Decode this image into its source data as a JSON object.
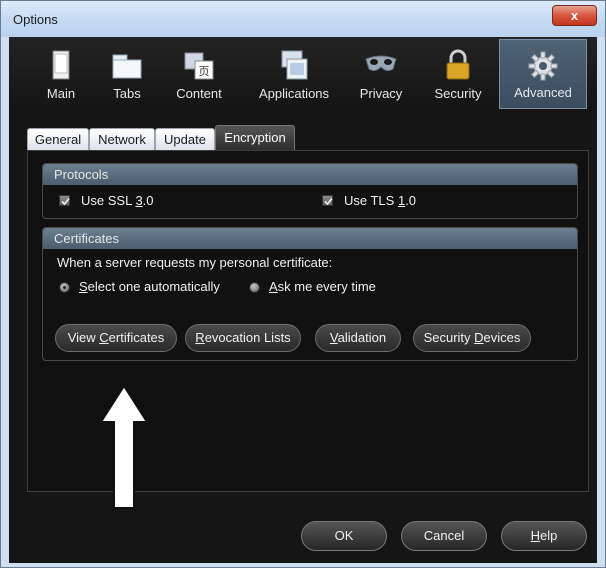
{
  "window": {
    "title": "Options",
    "close_label": "x"
  },
  "toolbar": {
    "items": [
      {
        "label": "Main",
        "icon": "main-icon"
      },
      {
        "label": "Tabs",
        "icon": "tabs-icon"
      },
      {
        "label": "Content",
        "icon": "content-icon"
      },
      {
        "label": "Applications",
        "icon": "applications-icon"
      },
      {
        "label": "Privacy",
        "icon": "privacy-mask-icon"
      },
      {
        "label": "Security",
        "icon": "padlock-icon"
      },
      {
        "label": "Advanced",
        "icon": "gear-icon",
        "selected": true
      }
    ]
  },
  "tabs": [
    {
      "label": "General"
    },
    {
      "label": "Network"
    },
    {
      "label": "Update"
    },
    {
      "label": "Encryption",
      "selected": true
    }
  ],
  "protocols": {
    "title": "Protocols",
    "ssl_pre": "Use SSL ",
    "ssl_key": "3",
    "ssl_post": ".0",
    "ssl_checked": true,
    "tls_pre": "Use TLS ",
    "tls_key": "1",
    "tls_post": ".0",
    "tls_checked": true
  },
  "certificates": {
    "title": "Certificates",
    "prompt": "When a server requests my personal certificate:",
    "opt1_key": "S",
    "opt1_rest": "elect one automatically",
    "opt1_selected": true,
    "opt2_key": "A",
    "opt2_rest": "sk me every time",
    "btn_view_pre": "View ",
    "btn_view_key": "C",
    "btn_view_post": "ertificates",
    "btn_revoke_key": "R",
    "btn_revoke_post": "evocation Lists",
    "btn_valid_key": "V",
    "btn_valid_post": "alidation",
    "btn_devices_pre": "Security ",
    "btn_devices_key": "D",
    "btn_devices_post": "evices"
  },
  "footer": {
    "ok": "OK",
    "cancel": "Cancel",
    "help_key": "H",
    "help_post": "elp"
  },
  "colors": {
    "selected_tool": "#4e6375",
    "group_header": "#5b6e80",
    "annotation_arrow": "#ffffff"
  }
}
